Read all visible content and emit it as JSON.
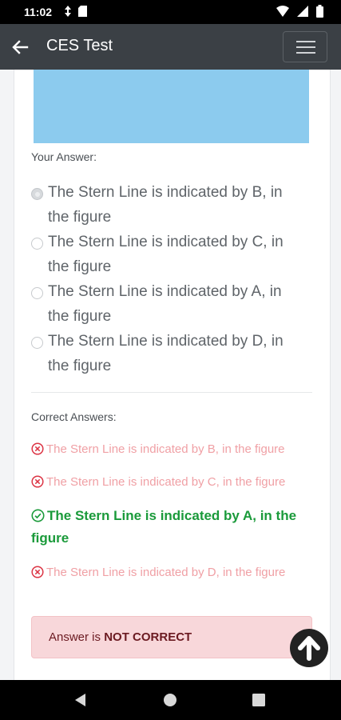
{
  "status_bar": {
    "time": "11:02"
  },
  "app_bar": {
    "title": "CES Test"
  },
  "question": {
    "your_answer_label": "Your Answer:",
    "options": [
      {
        "text": "The Stern Line is indicated by B, in the figure",
        "selected": true
      },
      {
        "text": "The Stern Line is indicated by C, in the figure",
        "selected": false
      },
      {
        "text": "The Stern Line is indicated by A, in the figure",
        "selected": false
      },
      {
        "text": "The Stern Line is indicated by D, in the figure",
        "selected": false
      }
    ]
  },
  "correct_answers": {
    "label": "Correct Answers:",
    "items": [
      {
        "text": "The Stern Line is indicated by B, in the figure",
        "correct": false
      },
      {
        "text": "The Stern Line is indicated by C, in the figure",
        "correct": false
      },
      {
        "text": "The Stern Line is indicated by A, in the figure",
        "correct": true
      },
      {
        "text": "The Stern Line is indicated by D, in the figure",
        "correct": false
      }
    ]
  },
  "result": {
    "prefix": "Answer is",
    "verdict": "NOT CORRECT"
  },
  "colors": {
    "correct": "#1a9a3a",
    "wrong": "#f0a0a5",
    "app_bar": "#3b4045",
    "alert_bg": "#f8d7da"
  }
}
